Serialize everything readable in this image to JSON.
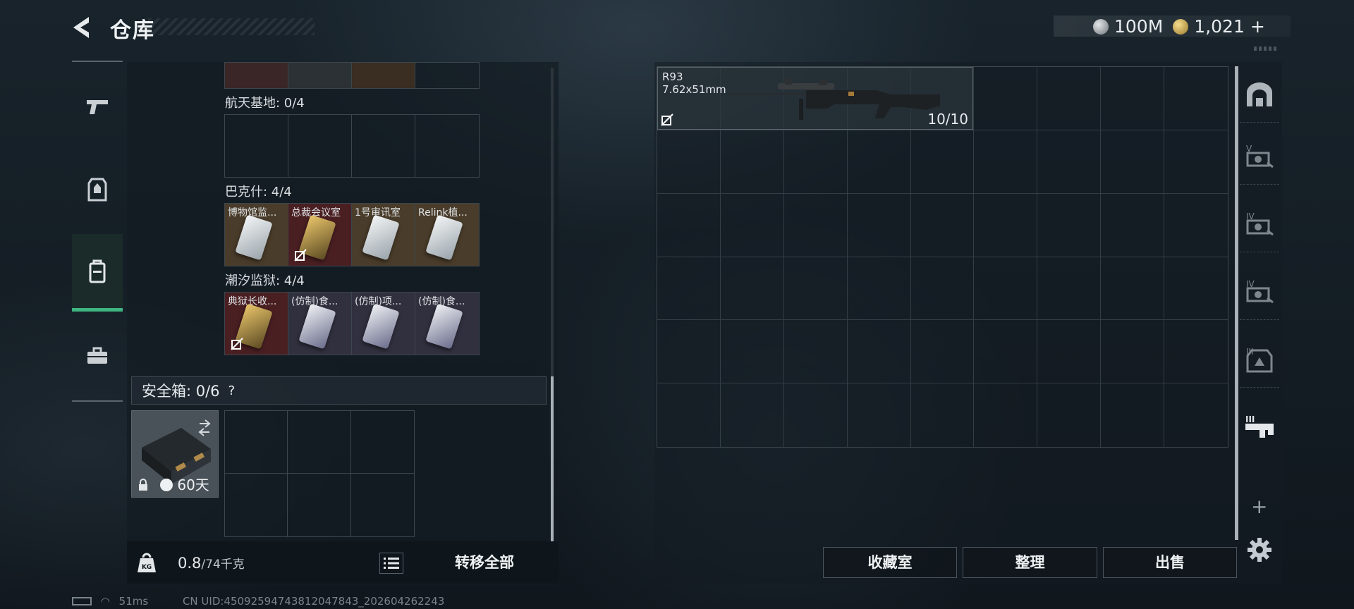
{
  "header": {
    "title": "仓库",
    "silver_amount": "100M",
    "gold_amount": "1,021"
  },
  "left_sidebar": {
    "items": [
      {
        "name": "weapon"
      },
      {
        "name": "armor"
      },
      {
        "name": "backpack",
        "active": true
      },
      {
        "name": "toolbox"
      }
    ]
  },
  "keycard_sections": [
    {
      "label": "航天基地: 0/4",
      "items": []
    },
    {
      "label": "巴克什: 4/4",
      "items": [
        "博物馆监...",
        "总裁会议室",
        "1号审讯室",
        "Relink植..."
      ]
    },
    {
      "label": "潮汐监狱: 4/4",
      "items": [
        "典狱长收...",
        "(仿制)食...",
        "(仿制)项...",
        "(仿制)食..."
      ]
    }
  ],
  "safe_box": {
    "label": "安全箱: 0/6",
    "help": "?",
    "duration": "60天"
  },
  "bottom_bar": {
    "weight_value": "0.8",
    "weight_max": "/74千克",
    "transfer_all": "转移全部"
  },
  "status_bar": {
    "ping": "51ms",
    "uid": "CN UID:4509259474381204784​3_202604262243"
  },
  "stash_item": {
    "name": "R93",
    "caliber": "7.62x51mm",
    "ammo": "10/10"
  },
  "actions": {
    "collection": "收藏室",
    "organize": "整理",
    "sell": "出售"
  },
  "right_sidebar": {
    "plus": "+"
  },
  "colors": {
    "accent": "#3fb582",
    "background": "#111a20"
  }
}
